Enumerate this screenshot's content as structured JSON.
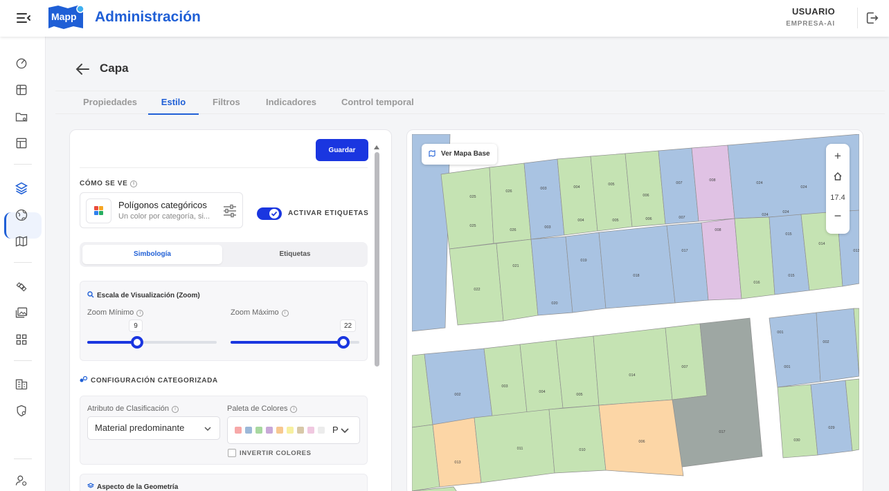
{
  "header": {
    "app_title": "Administración",
    "logo_text": "Mapp",
    "user_name": "USUARIO",
    "company": "EMPRESA-AI"
  },
  "sidebar": {
    "items": [
      {
        "icon": "gauge-icon"
      },
      {
        "icon": "grid-map-icon"
      },
      {
        "icon": "folder-settings-icon"
      },
      {
        "icon": "layout-icon"
      },
      {
        "icon": "layers-icon",
        "active": true
      },
      {
        "icon": "globe-icon"
      },
      {
        "icon": "map-icon"
      },
      {
        "icon": "satellite-icon"
      },
      {
        "icon": "images-icon"
      },
      {
        "icon": "apps-icon"
      },
      {
        "icon": "building-icon"
      },
      {
        "icon": "shield-settings-icon"
      },
      {
        "icon": "users-settings-icon"
      }
    ]
  },
  "page": {
    "title": "Capa",
    "tabs": [
      "Propiedades",
      "Estilo",
      "Filtros",
      "Indicadores",
      "Control temporal"
    ],
    "active_tab": "Estilo"
  },
  "style_panel": {
    "save_label": "Guardar",
    "how_it_looks": "CÓMO SE VE",
    "style_type_title": "Polígonos categóricos",
    "style_type_subtitle": "Un color por categoría, si...",
    "labels_toggle": "ACTIVAR ETIQUETAS",
    "labels_enabled": true,
    "subtabs": [
      "Simbología",
      "Etiquetas"
    ],
    "active_subtab": "Simbología",
    "zoom_section": "Escala de Visualización (Zoom)",
    "zoom_min_label": "Zoom Mínimo",
    "zoom_min_value": "9",
    "zoom_max_label": "Zoom Máximo",
    "zoom_max_value": "22",
    "zoom_range": [
      0,
      22
    ],
    "categorized_section": "CONFIGURACIÓN CATEGORIZADA",
    "attribute_label": "Atributo de Clasificación",
    "attribute_value": "Material predominante",
    "palette_label": "Paleta de Colores",
    "palette_text": "P",
    "palette_colors": [
      "#f7a8a8",
      "#9cb8d8",
      "#a8d8a0",
      "#c8a8d8",
      "#f7c890",
      "#f7f0a0",
      "#d8c8a8",
      "#f0c8e0",
      "#ececec"
    ],
    "invert_label": "INVERTIR COLORES",
    "geometry_section": "Aspecto de la Geometría"
  },
  "map": {
    "base_map_label": "Ver Mapa Base",
    "zoom_level": "17.4",
    "colors": {
      "green": "#c5e3b3",
      "blue": "#a9c3e2",
      "pink": "#e0c2e4",
      "orange": "#fcd6a6",
      "gray": "#9ea7a3"
    },
    "parcel_labels": [
      "025",
      "026",
      "003",
      "004",
      "005",
      "006",
      "007",
      "008",
      "024",
      "021",
      "019",
      "018",
      "017",
      "016",
      "015",
      "014",
      "022",
      "020",
      "002",
      "001",
      "009",
      "010",
      "011",
      "013",
      "029",
      "030"
    ]
  }
}
